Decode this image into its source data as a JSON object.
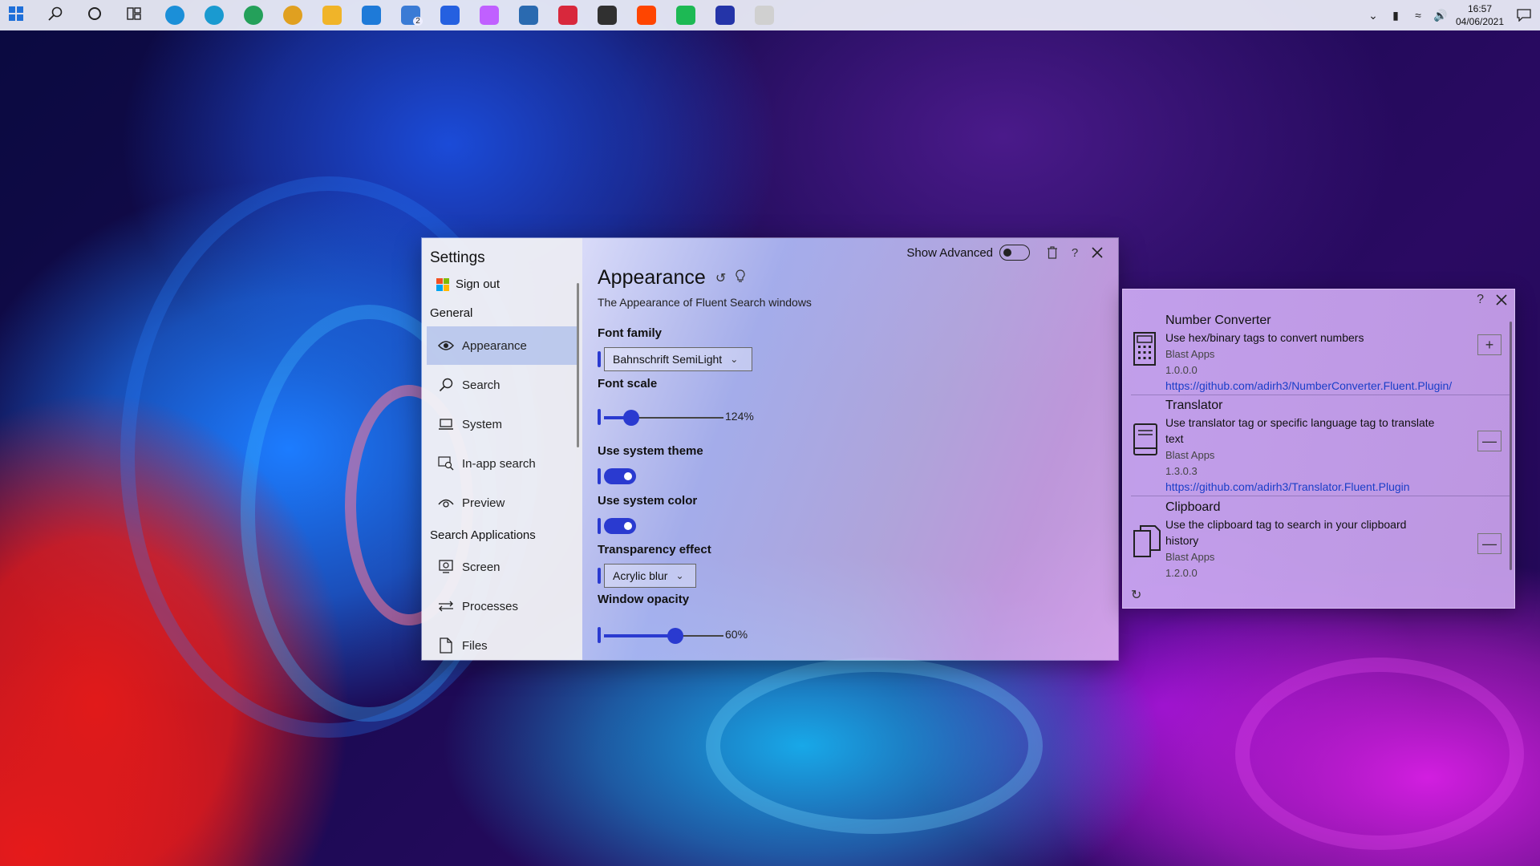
{
  "taskbar": {
    "apps": [
      {
        "icon": "windows-start-icon",
        "color": "#1e6fd9"
      },
      {
        "icon": "search-icon",
        "color": "#222222"
      },
      {
        "icon": "cortana-icon",
        "color": "#222222"
      },
      {
        "icon": "task-view-icon",
        "color": "#222222"
      },
      {
        "icon": "edge-icon",
        "color": "#1b8fd8"
      },
      {
        "icon": "edge-beta-icon",
        "color": "#1a9ad0"
      },
      {
        "icon": "edge-dev-icon",
        "color": "#24a05a"
      },
      {
        "icon": "edge-canary-icon",
        "color": "#e0a020"
      },
      {
        "icon": "file-explorer-icon",
        "color": "#f0b429"
      },
      {
        "icon": "mail-icon",
        "color": "#1e7ad8"
      },
      {
        "icon": "notepad-icon",
        "color": "#3a7bd5",
        "badge": "2"
      },
      {
        "icon": "todo-icon",
        "color": "#2560e0"
      },
      {
        "icon": "fluent-icon",
        "color": "#c060ff"
      },
      {
        "icon": "photos-icon",
        "color": "#2a6ab0"
      },
      {
        "icon": "media-icon",
        "color": "#d8283c"
      },
      {
        "icon": "store-icon",
        "color": "#303030"
      },
      {
        "icon": "reddit-icon",
        "color": "#ff4500"
      },
      {
        "icon": "spotify-icon",
        "color": "#1db954"
      },
      {
        "icon": "generic-app-icon",
        "color": "#2434a8"
      },
      {
        "icon": "send-icon",
        "color": "#d0d0d0"
      }
    ],
    "tray": {
      "time": "16:57",
      "date": "04/06/2021"
    }
  },
  "settings": {
    "title": "Settings",
    "sign_out": "Sign out",
    "section_general": "General",
    "section_search_apps": "Search Applications",
    "nav": [
      {
        "label": "Appearance",
        "icon": "eye-icon",
        "active": true
      },
      {
        "label": "Search",
        "icon": "search-icon"
      },
      {
        "label": "System",
        "icon": "laptop-icon"
      },
      {
        "label": "In-app search",
        "icon": "window-search-icon"
      },
      {
        "label": "Preview",
        "icon": "preview-icon"
      }
    ],
    "nav_apps": [
      {
        "label": "Screen",
        "icon": "screen-icon"
      },
      {
        "label": "Processes",
        "icon": "processes-icon"
      },
      {
        "label": "Files",
        "icon": "file-icon"
      }
    ],
    "show_advanced": "Show Advanced",
    "page": {
      "title": "Appearance",
      "subtitle": "The Appearance of Fluent Search windows",
      "font_family_label": "Font family",
      "font_family_value": "Bahnschrift SemiLight",
      "font_scale_label": "Font scale",
      "font_scale_value": "124%",
      "font_scale_level": 0.23,
      "system_theme_label": "Use system theme",
      "system_theme_on": true,
      "system_color_label": "Use system color",
      "system_color_on": true,
      "transparency_label": "Transparency effect",
      "transparency_value": "Acrylic blur",
      "opacity_label": "Window opacity",
      "opacity_value": "60%",
      "opacity_level": 0.6
    },
    "accent_color": "#2a3ad0"
  },
  "plugins": [
    {
      "name": "Number Converter",
      "description": "Use hex/binary tags to convert numbers",
      "author": "Blast Apps",
      "version": "1.0.0.0",
      "link": "https://github.com/adirh3/NumberConverter.Fluent.Plugin/",
      "icon": "calculator-icon",
      "action": "+"
    },
    {
      "name": "Translator",
      "description": "Use translator tag or specific language tag to translate text",
      "author": "Blast Apps",
      "version": "1.3.0.3",
      "link": "https://github.com/adirh3/Translator.Fluent.Plugin",
      "icon": "book-icon",
      "action": "—"
    },
    {
      "name": "Clipboard",
      "description": "Use the clipboard tag to search in your clipboard history",
      "author": "Blast Apps",
      "version": "1.2.0.0",
      "link": "",
      "icon": "clipboard-icon",
      "action": "—"
    }
  ]
}
